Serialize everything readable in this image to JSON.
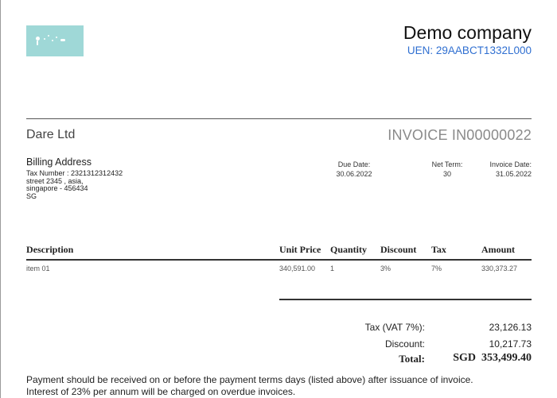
{
  "company": {
    "name": "Demo company",
    "uen": "UEN: 29AABCT1332L000"
  },
  "client": {
    "name": "Dare Ltd"
  },
  "invoice": {
    "title": "INVOICE IN00000022"
  },
  "billing": {
    "heading": "Billing Address",
    "tax_number": "Tax Number : 2321312312432",
    "street": "street 2345 , asia,",
    "city": "singapore - 456434",
    "country": "SG"
  },
  "meta": {
    "due_date_label": "Due Date:",
    "due_date": "30.06.2022",
    "net_term_label": "Net Term:",
    "net_term": "30",
    "invoice_date_label": "Invoice Date:",
    "invoice_date": "31.05.2022"
  },
  "table": {
    "headers": {
      "description": "Description",
      "unit_price": "Unit Price",
      "quantity": "Quantity",
      "discount": "Discount",
      "tax": "Tax",
      "amount": "Amount"
    },
    "rows": [
      {
        "description": "item 01",
        "unit_price": "340,591.00",
        "quantity": "1",
        "discount": "3%",
        "tax": "7%",
        "amount": "330,373.27"
      }
    ]
  },
  "summary": {
    "tax_label": "Tax (VAT 7%):",
    "tax_value": "23,126.13",
    "discount_label": "Discount:",
    "discount_value": "10,217.73",
    "total_label": "Total:",
    "total_value": "SGD  353,499.40"
  },
  "notes": [
    "Payment should be received on or before the payment terms days (listed above) after issuance of invoice.",
    "Interest of 23% per annum will be charged on overdue invoices."
  ],
  "colors": {
    "logo_bg": "#9fd8d7",
    "uen": "#2f6fd1",
    "invoice_title": "#8a8a8a"
  }
}
